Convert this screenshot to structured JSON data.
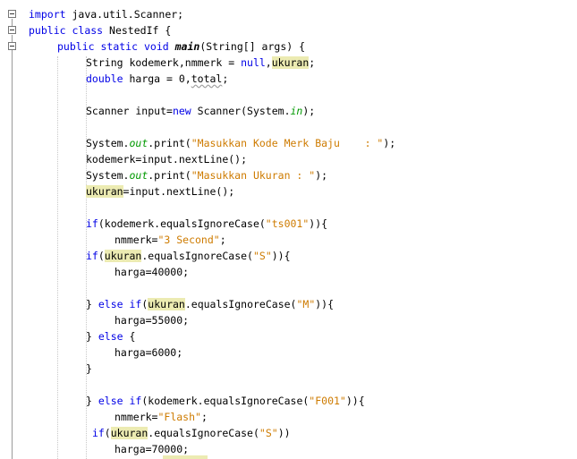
{
  "editor": {
    "code_lines": [
      {
        "indent": 0,
        "segments": [
          {
            "t": "import",
            "c": "kw"
          },
          {
            "t": " java.util.Scanner;"
          }
        ]
      },
      {
        "indent": 0,
        "segments": [
          {
            "t": "public",
            "c": "kw"
          },
          {
            "t": " "
          },
          {
            "t": "class",
            "c": "kw"
          },
          {
            "t": " NestedIf {"
          }
        ]
      },
      {
        "indent": 1,
        "segments": [
          {
            "t": "public",
            "c": "kw"
          },
          {
            "t": " "
          },
          {
            "t": "static",
            "c": "kw"
          },
          {
            "t": " "
          },
          {
            "t": "void",
            "c": "kw"
          },
          {
            "t": " "
          },
          {
            "t": "main",
            "c": "bold-it"
          },
          {
            "t": "(String[] args) {"
          }
        ]
      },
      {
        "indent": 2,
        "segments": [
          {
            "t": "String kodemerk,nmmerk = "
          },
          {
            "t": "null",
            "c": "kw"
          },
          {
            "t": ","
          },
          {
            "t": "ukuran",
            "c": "hl"
          },
          {
            "t": ";"
          }
        ]
      },
      {
        "indent": 2,
        "segments": [
          {
            "t": "double",
            "c": "kw"
          },
          {
            "t": " harga = 0,"
          },
          {
            "t": "total",
            "c": "warn"
          },
          {
            "t": ";"
          }
        ]
      },
      {
        "indent": 2,
        "segments": []
      },
      {
        "indent": 2,
        "segments": [
          {
            "t": "Scanner input="
          },
          {
            "t": "new",
            "c": "kw"
          },
          {
            "t": " Scanner(System."
          },
          {
            "t": "in",
            "c": "field"
          },
          {
            "t": ");"
          }
        ]
      },
      {
        "indent": 2,
        "segments": []
      },
      {
        "indent": 2,
        "segments": [
          {
            "t": "System."
          },
          {
            "t": "out",
            "c": "field"
          },
          {
            "t": ".print("
          },
          {
            "t": "\"Masukkan Kode Merk Baju    : \"",
            "c": "str"
          },
          {
            "t": ");"
          }
        ]
      },
      {
        "indent": 2,
        "segments": [
          {
            "t": "kodemerk=input.nextLine();"
          }
        ]
      },
      {
        "indent": 2,
        "segments": [
          {
            "t": "System."
          },
          {
            "t": "out",
            "c": "field"
          },
          {
            "t": ".print("
          },
          {
            "t": "\"Masukkan Ukuran : \"",
            "c": "str"
          },
          {
            "t": ");"
          }
        ]
      },
      {
        "indent": 2,
        "segments": [
          {
            "t": "ukuran",
            "c": "hl"
          },
          {
            "t": "=input.nextLine();"
          }
        ]
      },
      {
        "indent": 2,
        "segments": []
      },
      {
        "indent": 2,
        "segments": [
          {
            "t": "if",
            "c": "kw"
          },
          {
            "t": "(kodemerk.equalsIgnoreCase("
          },
          {
            "t": "\"ts001\"",
            "c": "str"
          },
          {
            "t": ")){"
          }
        ]
      },
      {
        "indent": 3,
        "segments": [
          {
            "t": "nmmerk="
          },
          {
            "t": "\"3 Second\"",
            "c": "str"
          },
          {
            "t": ";"
          }
        ]
      },
      {
        "indent": 2,
        "segments": [
          {
            "t": "if",
            "c": "kw"
          },
          {
            "t": "("
          },
          {
            "t": "ukuran",
            "c": "hl"
          },
          {
            "t": ".equalsIgnoreCase("
          },
          {
            "t": "\"S\"",
            "c": "str"
          },
          {
            "t": ")){"
          }
        ]
      },
      {
        "indent": 3,
        "segments": [
          {
            "t": "harga=40000;"
          }
        ]
      },
      {
        "indent": 2,
        "segments": []
      },
      {
        "indent": 2,
        "segments": [
          {
            "t": "} "
          },
          {
            "t": "else",
            "c": "kw"
          },
          {
            "t": " "
          },
          {
            "t": "if",
            "c": "kw"
          },
          {
            "t": "("
          },
          {
            "t": "ukuran",
            "c": "hl"
          },
          {
            "t": ".equalsIgnoreCase("
          },
          {
            "t": "\"M\"",
            "c": "str"
          },
          {
            "t": ")){"
          }
        ]
      },
      {
        "indent": 3,
        "segments": [
          {
            "t": "harga=55000;"
          }
        ]
      },
      {
        "indent": 2,
        "segments": [
          {
            "t": "} "
          },
          {
            "t": "else",
            "c": "kw"
          },
          {
            "t": " {"
          }
        ]
      },
      {
        "indent": 3,
        "segments": [
          {
            "t": "harga=6000;"
          }
        ]
      },
      {
        "indent": 2,
        "segments": [
          {
            "t": "}"
          }
        ]
      },
      {
        "indent": 2,
        "segments": []
      },
      {
        "indent": 2,
        "segments": [
          {
            "t": "} "
          },
          {
            "t": "else",
            "c": "kw"
          },
          {
            "t": " "
          },
          {
            "t": "if",
            "c": "kw"
          },
          {
            "t": "(kodemerk.equalsIgnoreCase("
          },
          {
            "t": "\"F001\"",
            "c": "str"
          },
          {
            "t": ")){"
          }
        ]
      },
      {
        "indent": 3,
        "segments": [
          {
            "t": "nmmerk="
          },
          {
            "t": "\"Flash\"",
            "c": "str"
          },
          {
            "t": ";"
          }
        ]
      },
      {
        "indent": 2,
        "segments": [
          {
            "t": " "
          },
          {
            "t": "if",
            "c": "kw"
          },
          {
            "t": "("
          },
          {
            "t": "ukuran",
            "c": "hl"
          },
          {
            "t": ".equalsIgnoreCase("
          },
          {
            "t": "\"S\"",
            "c": "str"
          },
          {
            "t": "))"
          }
        ]
      },
      {
        "indent": 3,
        "segments": [
          {
            "t": "harga=70000;"
          }
        ]
      }
    ]
  }
}
